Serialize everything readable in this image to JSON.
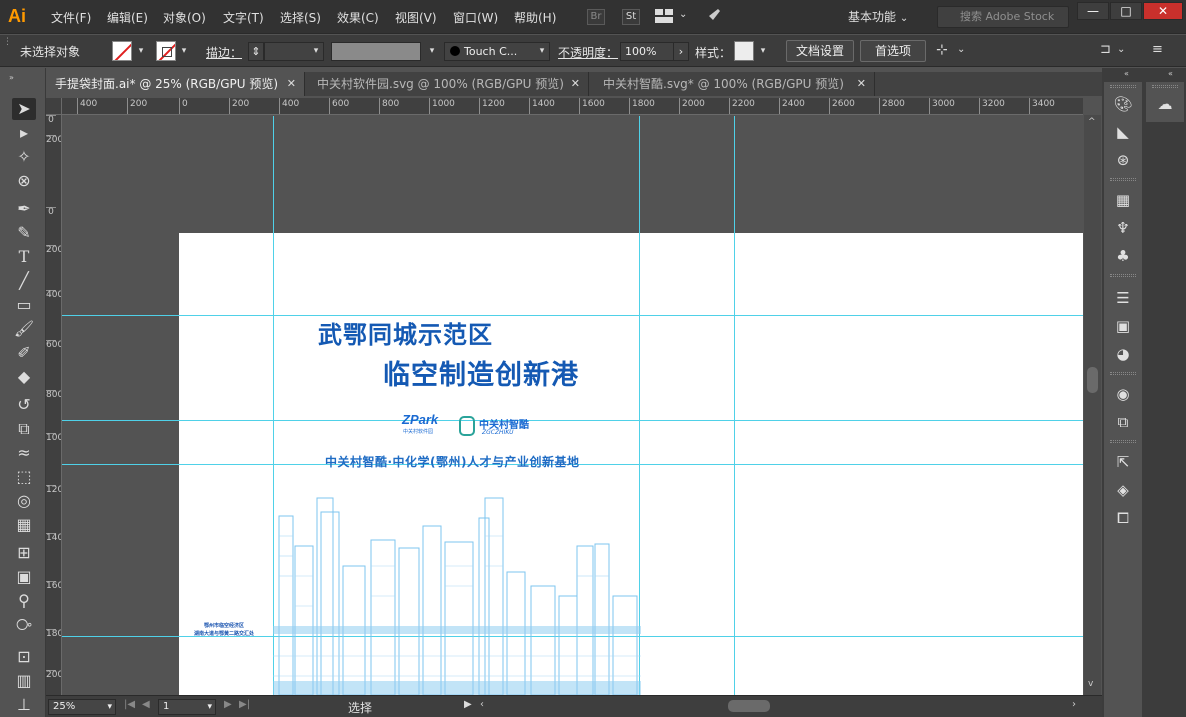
{
  "app": {
    "logo": "Ai"
  },
  "menu": [
    "文件(F)",
    "编辑(E)",
    "对象(O)",
    "文字(T)",
    "选择(S)",
    "效果(C)",
    "视图(V)",
    "窗口(W)",
    "帮助(H)"
  ],
  "app_buttons": {
    "bridge": "Br",
    "stock": "St"
  },
  "workspace": "基本功能",
  "search": {
    "placeholder": "搜索 Adobe Stock"
  },
  "control_bar": {
    "selection_label": "未选择对象",
    "stroke_label": "描边：",
    "brush_name": "Touch C...",
    "opacity_label": "不透明度：",
    "opacity_value": "100%",
    "style_label": "样式：",
    "doc_setup_button": "文档设置",
    "preferences_button": "首选项"
  },
  "tabs": [
    {
      "label": "手提袋封面.ai* @ 25% (RGB/GPU 预览)",
      "active": true
    },
    {
      "label": "中关村软件园.svg @ 100% (RGB/GPU 预览)",
      "active": false
    },
    {
      "label": "中关村智酷.svg* @ 100% (RGB/GPU 预览)",
      "active": false
    }
  ],
  "ruler_top_ticks": [
    "400",
    "200",
    "0",
    "200",
    "400",
    "600",
    "800",
    "1000",
    "1200",
    "1400",
    "1600",
    "1800",
    "2000",
    "2200",
    "2400",
    "2600",
    "2800",
    "3000",
    "3200",
    "3400"
  ],
  "ruler_left_ticks": [
    "0",
    "200",
    "0",
    "200",
    "400",
    "600",
    "800",
    "1000",
    "1200",
    "1400",
    "1600",
    "1800",
    "2000"
  ],
  "artwork": {
    "title_line1": "武鄂同城示范区",
    "title_line2": "临空制造创新港",
    "zpark_logo": "ZPark",
    "zpark_sub": "中关村软件园",
    "zgc_logo": "中关村智酷",
    "zgc_sub": "ZGCZHIKU",
    "subtitle": "中关村智酷·中化学(鄂州)人才与产业创新基地",
    "caption_line1": "鄂州市临空经济区",
    "caption_line2": "湖南大道与鄂黄二路交汇处"
  },
  "status_bar": {
    "zoom": "25%",
    "artboard_number": "1",
    "status_text": "选择"
  },
  "colors": {
    "title_blue": "#1459b3",
    "guide_cyan": "#4fd1e8",
    "ai_orange": "#ff9a00"
  }
}
